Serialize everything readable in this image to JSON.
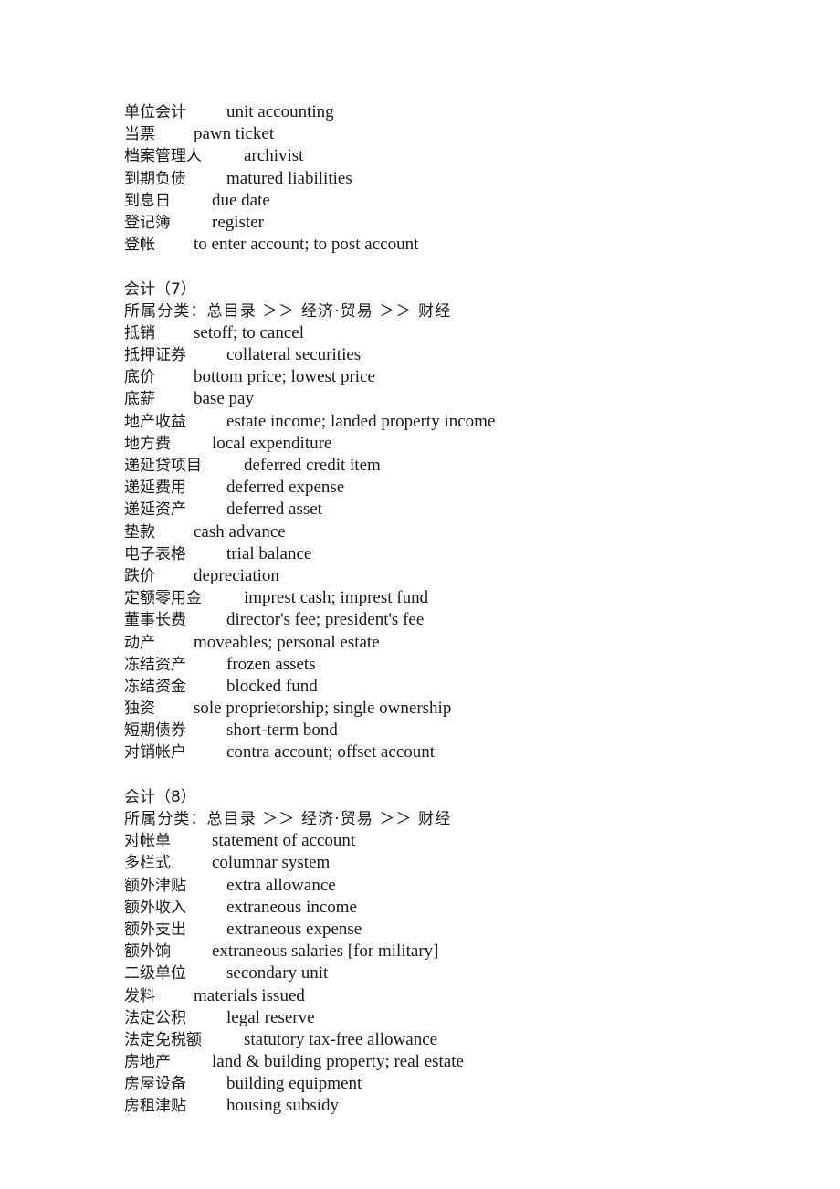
{
  "document": {
    "page_background": "#ffffff",
    "text_color": "#1a1a1a"
  },
  "sections": [
    {
      "id": "accounting-7-tail",
      "heading": null,
      "category": null,
      "entries": [
        {
          "term": "单位会计",
          "gloss": "unit accounting"
        },
        {
          "term": "当票",
          "gloss": "pawn ticket"
        },
        {
          "term": "档案管理人",
          "gloss": "archivist"
        },
        {
          "term": "到期负债",
          "gloss": "matured liabilities"
        },
        {
          "term": "到息日",
          "gloss": "due date"
        },
        {
          "term": "登记簿",
          "gloss": "register"
        },
        {
          "term": "登帐",
          "gloss": "to enter account; to post account"
        }
      ]
    },
    {
      "id": "accounting-7",
      "heading": "会计（7）",
      "category": "所属分类：总目录 ＞＞ 经济·贸易 ＞＞ 财经",
      "entries": [
        {
          "term": "抵销",
          "gloss": "setoff; to cancel"
        },
        {
          "term": "抵押证券",
          "gloss": "collateral securities"
        },
        {
          "term": "底价",
          "gloss": "bottom price; lowest price"
        },
        {
          "term": "底薪",
          "gloss": "base pay"
        },
        {
          "term": "地产收益",
          "gloss": "estate income; landed property income"
        },
        {
          "term": "地方费",
          "gloss": "local expenditure"
        },
        {
          "term": "递延贷项目",
          "gloss": "deferred credit item"
        },
        {
          "term": "递延费用",
          "gloss": "deferred expense"
        },
        {
          "term": "递延资产",
          "gloss": "deferred asset"
        },
        {
          "term": "垫款",
          "gloss": "cash advance"
        },
        {
          "term": "电子表格",
          "gloss": "trial balance"
        },
        {
          "term": "跌价",
          "gloss": "depreciation"
        },
        {
          "term": "定额零用金",
          "gloss": "imprest cash; imprest fund"
        },
        {
          "term": "董事长费",
          "gloss": "director's fee; president's fee"
        },
        {
          "term": "动产",
          "gloss": "moveables; personal estate"
        },
        {
          "term": "冻结资产",
          "gloss": "frozen assets"
        },
        {
          "term": "冻结资金",
          "gloss": "blocked fund"
        },
        {
          "term": "独资",
          "gloss": "sole proprietorship; single ownership"
        },
        {
          "term": "短期债券",
          "gloss": "short-term bond"
        },
        {
          "term": "对销帐户",
          "gloss": "contra account; offset account"
        }
      ]
    },
    {
      "id": "accounting-8",
      "heading": "会计（8）",
      "category": "所属分类：总目录 ＞＞ 经济·贸易 ＞＞ 财经",
      "entries": [
        {
          "term": "对帐单",
          "gloss": "statement of account"
        },
        {
          "term": "多栏式",
          "gloss": "columnar system"
        },
        {
          "term": "额外津贴",
          "gloss": "extra allowance"
        },
        {
          "term": "额外收入",
          "gloss": "extraneous income"
        },
        {
          "term": "额外支出",
          "gloss": "extraneous expense"
        },
        {
          "term": "额外饷",
          "gloss": "extraneous salaries [for military]"
        },
        {
          "term": "二级单位",
          "gloss": "secondary unit"
        },
        {
          "term": "发料",
          "gloss": "materials issued"
        },
        {
          "term": "法定公积",
          "gloss": "legal reserve"
        },
        {
          "term": "法定免税额",
          "gloss": "statutory tax-free allowance"
        },
        {
          "term": "房地产",
          "gloss": "land & building property; real estate"
        },
        {
          "term": "房屋设备",
          "gloss": "building equipment"
        },
        {
          "term": "房租津贴",
          "gloss": "housing subsidy"
        }
      ]
    }
  ]
}
